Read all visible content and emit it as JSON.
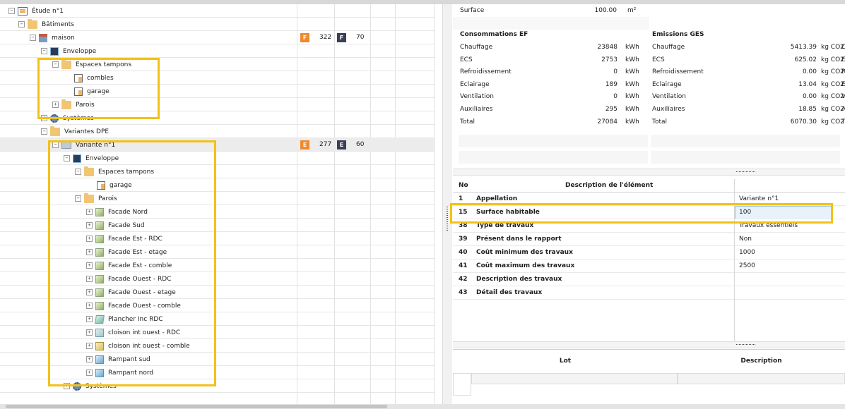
{
  "tree": {
    "nodes": [
      {
        "label": "Étude n°1"
      },
      {
        "label": "Bâtiments"
      },
      {
        "label": "maison",
        "badges": [
          {
            "letter": "F",
            "value": "322",
            "color": "#ef8a2a"
          },
          {
            "letter": "F",
            "value": "70",
            "color": "#3a3f56"
          }
        ]
      },
      {
        "label": "Enveloppe"
      },
      {
        "label": "Espaces tampons"
      },
      {
        "label": "combles"
      },
      {
        "label": "garage"
      },
      {
        "label": "Parois"
      },
      {
        "label": "Systèmes"
      },
      {
        "label": "Variantes DPE"
      },
      {
        "label": "Variante n°1",
        "badges": [
          {
            "letter": "E",
            "value": "277",
            "color": "#ef8a2a"
          },
          {
            "letter": "E",
            "value": "60",
            "color": "#3a3f56"
          }
        ]
      },
      {
        "label": "Enveloppe"
      },
      {
        "label": "Espaces tampons"
      },
      {
        "label": "garage"
      },
      {
        "label": "Parois"
      },
      {
        "label": "Facade Nord"
      },
      {
        "label": "Facade Sud"
      },
      {
        "label": "Facade Est - RDC"
      },
      {
        "label": "Facade Est - etage"
      },
      {
        "label": "Facade Est - comble"
      },
      {
        "label": "Facade Ouest - RDC"
      },
      {
        "label": "Facade Ouest - etage"
      },
      {
        "label": "Facade Ouest - comble"
      },
      {
        "label": "Plancher Inc RDC"
      },
      {
        "label": "cloison int ouest - RDC"
      },
      {
        "label": "cloison int ouest - comble"
      },
      {
        "label": "Rampant sud"
      },
      {
        "label": "Rampant nord"
      },
      {
        "label": "Systèmes"
      }
    ]
  },
  "results": {
    "surface_label": "Surface",
    "surface_value": "100.00",
    "surface_unit": "m²",
    "ef_title": "Consommations EF",
    "ges_title": "Emissions GES",
    "ef_rows": [
      {
        "label": "Chauffage",
        "value": "23848",
        "unit": "kWh"
      },
      {
        "label": "ECS",
        "value": "2753",
        "unit": "kWh"
      },
      {
        "label": "Refroidissement",
        "value": "0",
        "unit": "kWh"
      },
      {
        "label": "Eclairage",
        "value": "189",
        "unit": "kWh"
      },
      {
        "label": "Ventilation",
        "value": "0",
        "unit": "kWh"
      },
      {
        "label": "Auxiliaires",
        "value": "295",
        "unit": "kWh"
      },
      {
        "label": "Total",
        "value": "27084",
        "unit": "kWh"
      }
    ],
    "ges_rows": [
      {
        "label": "Chauffage",
        "value": "5413.39",
        "unit": "kg CO2"
      },
      {
        "label": "ECS",
        "value": "625.02",
        "unit": "kg CO2"
      },
      {
        "label": "Refroidissement",
        "value": "0.00",
        "unit": "kg CO2"
      },
      {
        "label": "Eclairage",
        "value": "13.04",
        "unit": "kg CO2"
      },
      {
        "label": "Ventilation",
        "value": "0.00",
        "unit": "kg CO2"
      },
      {
        "label": "Auxiliaires",
        "value": "18.85",
        "unit": "kg CO2"
      },
      {
        "label": "Total",
        "value": "6070.30",
        "unit": "kg CO2"
      }
    ],
    "edge_letters": [
      "C",
      "E",
      "R",
      "E",
      "V",
      "A",
      "T"
    ]
  },
  "properties": {
    "header_no": "No",
    "header_desc": "Description de l'élément",
    "rows": [
      {
        "no": "1",
        "name": "Appellation",
        "value": "Variante n°1"
      },
      {
        "no": "15",
        "name": "Surface habitable",
        "value": "100",
        "selected": true
      },
      {
        "no": "38",
        "name": "Type de travaux",
        "value": "Travaux essentiels"
      },
      {
        "no": "39",
        "name": "Présent dans le rapport",
        "value": "Non"
      },
      {
        "no": "40",
        "name": "Coût minimum des travaux",
        "value": "1000"
      },
      {
        "no": "41",
        "name": "Coût maximum des travaux",
        "value": "2500"
      },
      {
        "no": "42",
        "name": "Description des travaux",
        "value": ""
      },
      {
        "no": "43",
        "name": "Détail des travaux",
        "value": ""
      }
    ]
  },
  "lot_table": {
    "col_lot": "Lot",
    "col_desc": "Description"
  },
  "colors": {
    "highlight": "#f3c116",
    "badge_orange": "#ef8a2a",
    "badge_navy": "#3a3f56"
  }
}
